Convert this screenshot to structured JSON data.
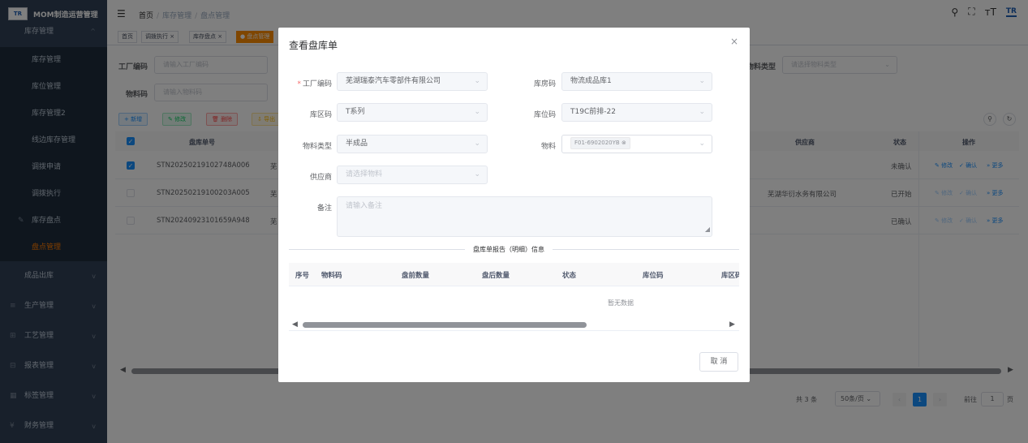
{
  "app": {
    "logo_text": "TR",
    "title": "MOM制造运营管理"
  },
  "sidebar": {
    "section": "库存管理",
    "sub_items": [
      {
        "label": "库存管理",
        "active": false
      },
      {
        "label": "库位管理",
        "active": false
      },
      {
        "label": "库存管理2",
        "active": false
      },
      {
        "label": "线边库存管理",
        "active": false
      },
      {
        "label": "调拨申请",
        "active": false
      },
      {
        "label": "调拨执行",
        "active": false
      },
      {
        "label": "库存盘点",
        "active": false
      },
      {
        "label": "盘点管理",
        "active": true
      }
    ],
    "groups": [
      "成品出库",
      "生产管理",
      "工艺管理",
      "报表管理",
      "标签管理",
      "财务管理"
    ]
  },
  "header": {
    "breadcrumb": [
      "首页",
      "库存管理",
      "盘点管理"
    ],
    "logo_text": "TR"
  },
  "tags": [
    "首页",
    "调拨执行",
    "库存盘点",
    "盘点管理"
  ],
  "search": {
    "factory_label": "工厂编码",
    "factory_placeholder": "请输入工厂编码",
    "material_label": "物料码",
    "material_placeholder": "请输入物料码",
    "mtype_label": "物料类型",
    "mtype_placeholder": "请选择物料类型"
  },
  "toolbar": {
    "add": "+ 新增",
    "edit": "修改",
    "delete": "删除",
    "export": "导出"
  },
  "table": {
    "columns": [
      "盘库单号",
      "供应商",
      "状态",
      "操作"
    ],
    "rows": [
      {
        "no": "STN20250219102748A006",
        "supplier": "",
        "status": "未确认",
        "checked": true
      },
      {
        "no": "STN20250219100203A005",
        "supplier": "芜湖华衍水务有限公司",
        "status": "已开始",
        "checked": false
      },
      {
        "no": "STN20240923101659A948",
        "supplier": "",
        "status": "已确认",
        "checked": false
      }
    ],
    "row_prefix": "芜",
    "ops": {
      "edit": "修改",
      "confirm": "确认",
      "more": "更多"
    }
  },
  "pagination": {
    "total": "共 3 条",
    "page_size": "50条/页",
    "current": "1",
    "goto": "前往",
    "goto_value": "1",
    "page_unit": "页"
  },
  "dialog": {
    "title": "查看盘库单",
    "fields": {
      "factory_label": "工厂编码",
      "factory_value": "芜湖瑞泰汽车零部件有限公司",
      "warehouse_label": "库房码",
      "warehouse_value": "物流成品库1",
      "area_label": "库区码",
      "area_value": "T系列",
      "location_label": "库位码",
      "location_value": "T19C前排-22",
      "mtype_label": "物料类型",
      "mtype_value": "半成品",
      "material_label": "物料",
      "material_chip": "F01-6902020YB",
      "supplier_label": "供应商",
      "supplier_placeholder": "请选择物料",
      "remark_label": "备注",
      "remark_placeholder": "请输入备注"
    },
    "section_title": "盘库单报告（明细）信息",
    "detail_columns": [
      "序号",
      "物料码",
      "盘前数量",
      "盘后数量",
      "状态",
      "库位码",
      "库区码"
    ],
    "empty_text": "暂无数据",
    "cancel": "取 消"
  }
}
